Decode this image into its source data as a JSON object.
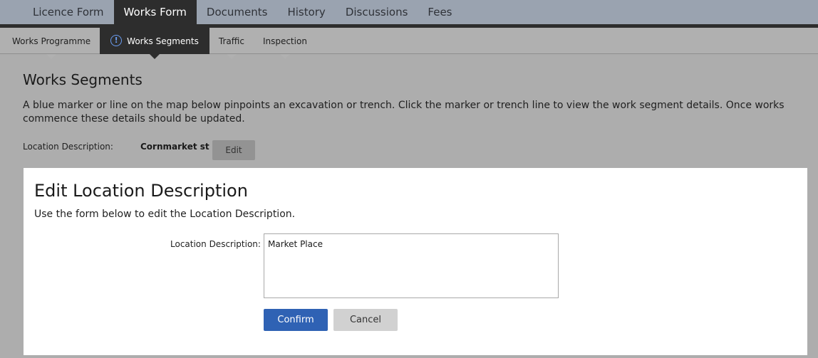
{
  "top_tabs": [
    {
      "label": "Licence Form",
      "active": false
    },
    {
      "label": "Works Form",
      "active": true
    },
    {
      "label": "Documents",
      "active": false
    },
    {
      "label": "History",
      "active": false
    },
    {
      "label": "Discussions",
      "active": false
    },
    {
      "label": "Fees",
      "active": false
    }
  ],
  "sub_tabs": [
    {
      "label": "Works Programme",
      "active": false
    },
    {
      "label": "Works Segments",
      "active": true,
      "icon": "info-icon"
    },
    {
      "label": "Traffic",
      "active": false
    },
    {
      "label": "Inspection",
      "active": false
    }
  ],
  "page": {
    "title": "Works Segments",
    "intro": "A blue marker or line on the map below pinpoints an excavation or trench. Click the marker or trench line to view the work segment details. Once works commence these details should be updated.",
    "location_label": "Location Description:",
    "location_value": "Cornmarket st",
    "edit_label": "Edit"
  },
  "modal": {
    "title": "Edit Location Description",
    "description": "Use the form below to edit the Location Description.",
    "field_label": "Location Description:",
    "field_value": "Market Place",
    "confirm_label": "Confirm",
    "cancel_label": "Cancel"
  },
  "colors": {
    "active_tab": "#2d2d2d",
    "confirm": "#2f62b4",
    "overlay": "#adadad"
  }
}
